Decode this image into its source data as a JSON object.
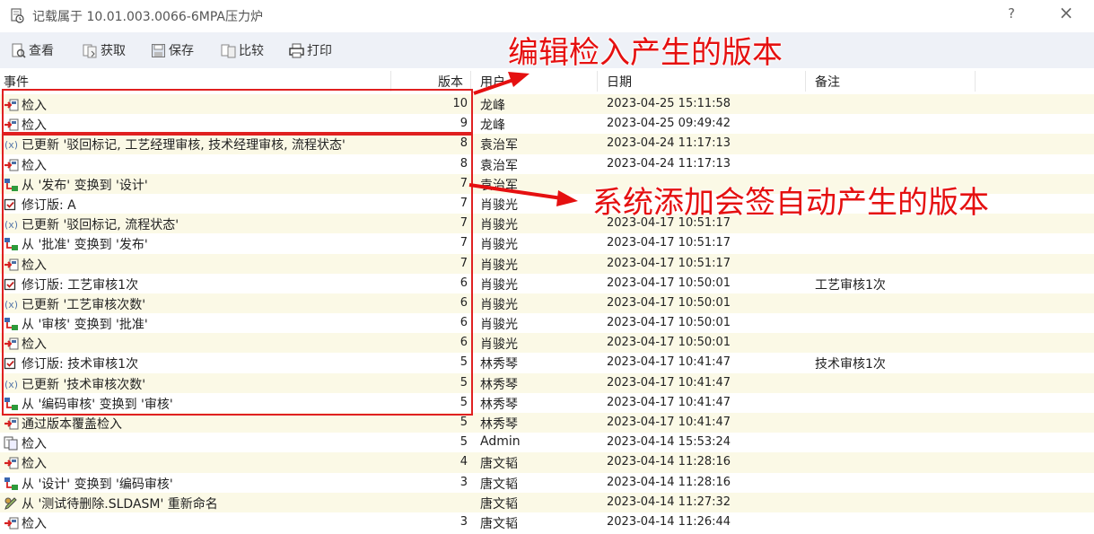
{
  "window": {
    "title": "记载属于 10.01.003.0066-6MPA压力炉",
    "help": "?",
    "close": "×"
  },
  "toolbar": [
    {
      "label": "查看",
      "icon": "view-icon",
      "name": "view"
    },
    {
      "label": "获取",
      "icon": "get-icon",
      "name": "get"
    },
    {
      "label": "保存",
      "icon": "save-icon",
      "name": "save"
    },
    {
      "label": "比较",
      "icon": "compare-icon",
      "name": "compare"
    },
    {
      "label": "打印",
      "icon": "print-icon",
      "name": "print"
    }
  ],
  "columns": {
    "event": "事件",
    "version": "版本",
    "user": "用户",
    "date": "日期",
    "note": "备注"
  },
  "rows": [
    {
      "icon": "checkin-icon",
      "event": "检入",
      "version": "10",
      "user": "龙峰",
      "date": "2023-04-25 15:11:58",
      "note": ""
    },
    {
      "icon": "checkin-icon",
      "event": "检入",
      "version": "9",
      "user": "龙峰",
      "date": "2023-04-25 09:49:42",
      "note": ""
    },
    {
      "icon": "variable-icon",
      "event": "已更新 '驳回标记, 工艺经理审核, 技术经理审核, 流程状态'",
      "version": "8",
      "user": "袁治军",
      "date": "2023-04-24 11:17:13",
      "note": ""
    },
    {
      "icon": "checkin-icon",
      "event": "检入",
      "version": "8",
      "user": "袁治军",
      "date": "2023-04-24 11:17:13",
      "note": ""
    },
    {
      "icon": "transition-icon",
      "event": "从 '发布' 变换到 '设计'",
      "version": "7",
      "user": "袁治军",
      "date": "",
      "note": ""
    },
    {
      "icon": "revision-icon",
      "event": "修订版: A",
      "version": "7",
      "user": "肖骏光",
      "date": "",
      "note": ""
    },
    {
      "icon": "variable-icon",
      "event": "已更新 '驳回标记, 流程状态'",
      "version": "7",
      "user": "肖骏光",
      "date": "2023-04-17 10:51:17",
      "note": ""
    },
    {
      "icon": "transition-icon",
      "event": "从 '批准' 变换到 '发布'",
      "version": "7",
      "user": "肖骏光",
      "date": "2023-04-17 10:51:17",
      "note": ""
    },
    {
      "icon": "checkin-icon",
      "event": "检入",
      "version": "7",
      "user": "肖骏光",
      "date": "2023-04-17 10:51:17",
      "note": ""
    },
    {
      "icon": "revision-icon",
      "event": "修订版: 工艺审核1次",
      "version": "6",
      "user": "肖骏光",
      "date": "2023-04-17 10:50:01",
      "note": "工艺审核1次"
    },
    {
      "icon": "variable-icon",
      "event": "已更新 '工艺审核次数'",
      "version": "6",
      "user": "肖骏光",
      "date": "2023-04-17 10:50:01",
      "note": ""
    },
    {
      "icon": "transition-icon",
      "event": "从 '审核' 变换到 '批准'",
      "version": "6",
      "user": "肖骏光",
      "date": "2023-04-17 10:50:01",
      "note": ""
    },
    {
      "icon": "checkin-icon",
      "event": "检入",
      "version": "6",
      "user": "肖骏光",
      "date": "2023-04-17 10:50:01",
      "note": ""
    },
    {
      "icon": "revision-icon",
      "event": "修订版: 技术审核1次",
      "version": "5",
      "user": "林秀琴",
      "date": "2023-04-17 10:41:47",
      "note": "技术审核1次"
    },
    {
      "icon": "variable-icon",
      "event": "已更新 '技术审核次数'",
      "version": "5",
      "user": "林秀琴",
      "date": "2023-04-17 10:41:47",
      "note": ""
    },
    {
      "icon": "transition-icon",
      "event": "从 '编码审核' 变换到 '审核'",
      "version": "5",
      "user": "林秀琴",
      "date": "2023-04-17 10:41:47",
      "note": ""
    },
    {
      "icon": "checkin-icon",
      "event": "通过版本覆盖检入",
      "version": "5",
      "user": "林秀琴",
      "date": "2023-04-17 10:41:47",
      "note": ""
    },
    {
      "icon": "add-icon",
      "event": "检入",
      "version": "5",
      "user": "Admin",
      "date": "2023-04-14 15:53:24",
      "note": ""
    },
    {
      "icon": "checkin-icon",
      "event": "检入",
      "version": "4",
      "user": "唐文韬",
      "date": "2023-04-14 11:28:16",
      "note": ""
    },
    {
      "icon": "transition-icon",
      "event": "从 '设计' 变换到 '编码审核'",
      "version": "3",
      "user": "唐文韬",
      "date": "2023-04-14 11:28:16",
      "note": ""
    },
    {
      "icon": "rename-icon",
      "event": "从 '测试待删除.SLDASM' 重新命名",
      "version": "",
      "user": "唐文韬",
      "date": "2023-04-14 11:27:32",
      "note": ""
    },
    {
      "icon": "checkin-icon",
      "event": "检入",
      "version": "3",
      "user": "唐文韬",
      "date": "2023-04-14 11:26:44",
      "note": ""
    }
  ],
  "annotations": {
    "top": "编辑检入产生的版本",
    "middle": "系统添加会签自动产生的版本",
    "color": "#e51010"
  }
}
